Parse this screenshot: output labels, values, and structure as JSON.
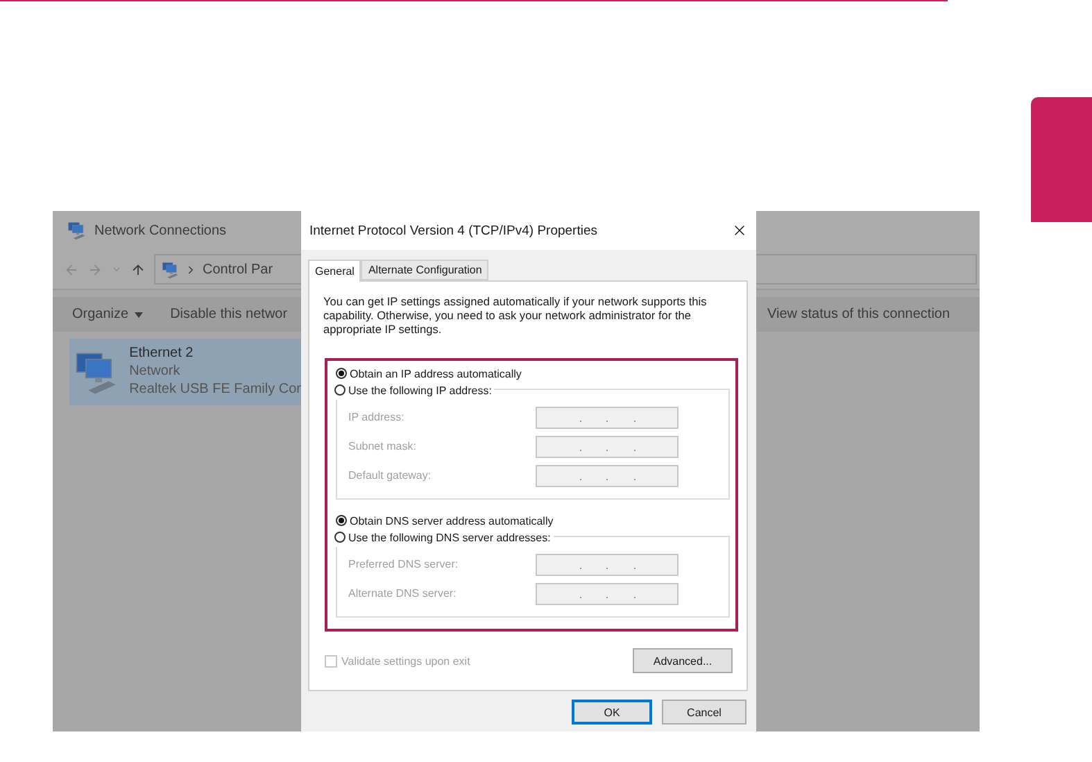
{
  "explorer": {
    "title": "Network Connections",
    "address": "Control Par",
    "toolbar": [
      {
        "label": "Organize",
        "kind": "menu"
      },
      {
        "label": "Disable this networ",
        "kind": "action"
      }
    ],
    "toolbar_right": "View status of this connection",
    "connection": {
      "name": "Ethernet 2",
      "network": "Network",
      "adapter": "Realtek USB FE Family Cor",
      "selected": true
    }
  },
  "dialog": {
    "title": "Internet Protocol Version 4 (TCP/IPv4) Properties",
    "tabs": [
      {
        "label": "General",
        "selected": true
      },
      {
        "label": "Alternate Configuration",
        "selected": false
      }
    ],
    "description": "You can get IP settings assigned automatically if your network supports this capability. Otherwise, you need to ask your network administrator for the appropriate IP settings.",
    "ip": {
      "auto": {
        "label": "Obtain an IP address automatically",
        "selected": true
      },
      "manual": {
        "label": "Use the following IP address:",
        "selected": false
      },
      "fields": [
        {
          "label": "IP address:",
          "disabled": true
        },
        {
          "label": "Subnet mask:",
          "disabled": true
        },
        {
          "label": "Default gateway:",
          "disabled": true
        }
      ]
    },
    "dns": {
      "auto": {
        "label": "Obtain DNS server address automatically",
        "selected": true
      },
      "manual": {
        "label": "Use the following DNS server addresses:",
        "selected": false
      },
      "fields": [
        {
          "label": "Preferred DNS server:",
          "disabled": true
        },
        {
          "label": "Alternate DNS server:",
          "disabled": true
        }
      ]
    },
    "validate": {
      "label": "Validate settings upon exit",
      "checked": false,
      "disabled": true
    },
    "advanced": "Advanced...",
    "buttons": [
      {
        "label": "OK",
        "default": true
      },
      {
        "label": "Cancel",
        "default": false
      }
    ]
  }
}
